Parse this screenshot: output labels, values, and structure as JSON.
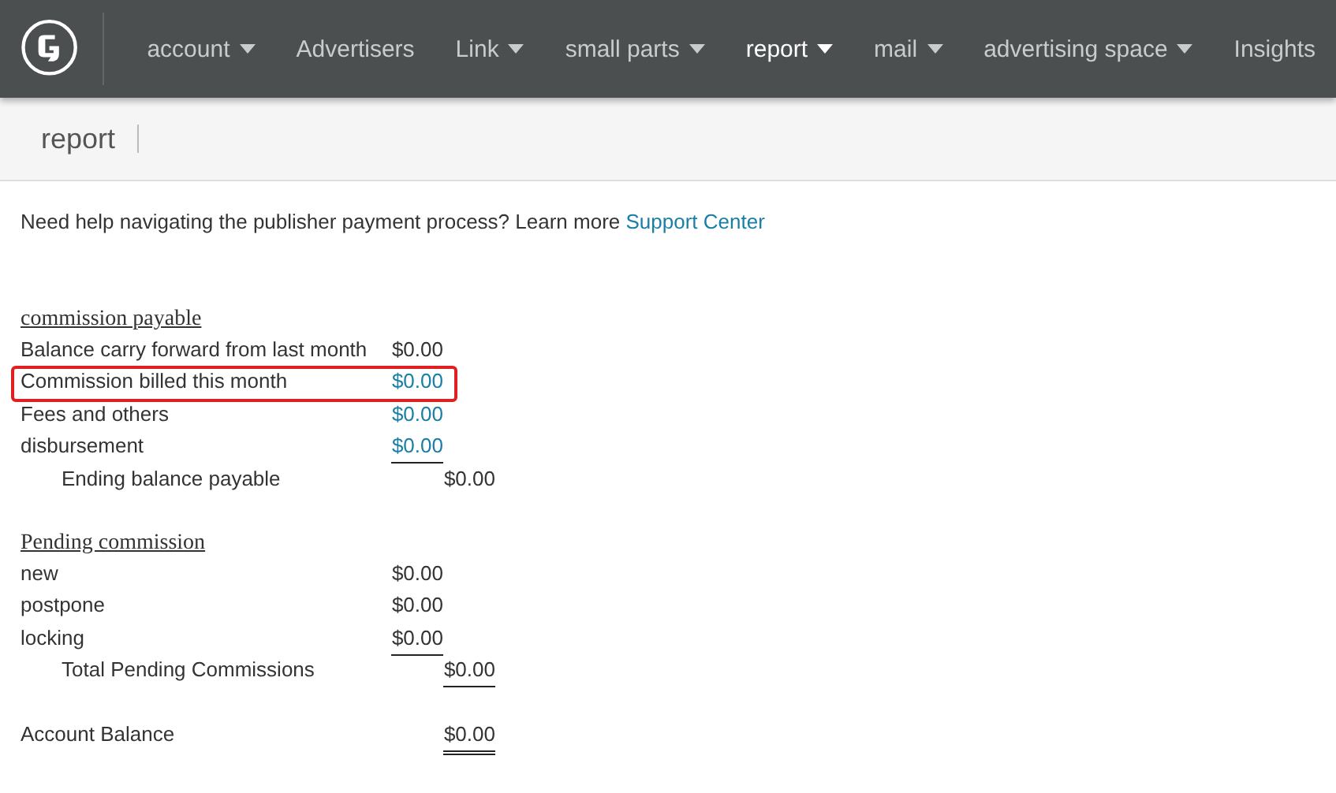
{
  "nav": {
    "items": [
      {
        "label": "account",
        "dropdown": true,
        "selected": false
      },
      {
        "label": "Advertisers",
        "dropdown": false,
        "selected": false
      },
      {
        "label": "Link",
        "dropdown": true,
        "selected": false
      },
      {
        "label": "small parts",
        "dropdown": true,
        "selected": false
      },
      {
        "label": "report",
        "dropdown": true,
        "selected": true
      },
      {
        "label": "mail",
        "dropdown": true,
        "selected": false
      },
      {
        "label": "advertising space",
        "dropdown": true,
        "selected": false
      },
      {
        "label": "Insights",
        "dropdown": false,
        "selected": false
      }
    ]
  },
  "page_title": "report",
  "help": {
    "text": "Need help navigating the publisher payment process? Learn more",
    "link": "Support Center"
  },
  "sections": [
    {
      "title": "commission payable",
      "rows": [
        {
          "kind": "item",
          "label": "Balance carry forward from last month",
          "amount": "$0.00",
          "link": false,
          "underlined": false,
          "highlighted": false
        },
        {
          "kind": "item",
          "label": "Commission billed this month",
          "amount": "$0.00",
          "link": true,
          "underlined": false,
          "highlighted": true
        },
        {
          "kind": "item",
          "label": "Fees and others",
          "amount": "$0.00",
          "link": true,
          "underlined": false,
          "highlighted": false
        },
        {
          "kind": "item",
          "label": "disbursement",
          "amount": "$0.00",
          "link": true,
          "underlined": true,
          "highlighted": false
        },
        {
          "kind": "total",
          "label": "Ending balance payable",
          "amount": "$0.00",
          "link": false,
          "underlined": false,
          "highlighted": false
        }
      ]
    },
    {
      "title": "Pending commission",
      "rows": [
        {
          "kind": "item",
          "label": "new",
          "amount": "$0.00",
          "link": false,
          "underlined": false,
          "highlighted": false
        },
        {
          "kind": "item",
          "label": "postpone",
          "amount": "$0.00",
          "link": false,
          "underlined": false,
          "highlighted": false
        },
        {
          "kind": "item",
          "label": "locking",
          "amount": "$0.00",
          "link": false,
          "underlined": true,
          "highlighted": false
        },
        {
          "kind": "total",
          "label": "Total Pending Commissions",
          "amount": "$0.00",
          "link": false,
          "underlined": true,
          "highlighted": false
        }
      ]
    }
  ],
  "account_balance": {
    "label": "Account Balance",
    "amount": "$0.00",
    "double_underlined": true
  }
}
